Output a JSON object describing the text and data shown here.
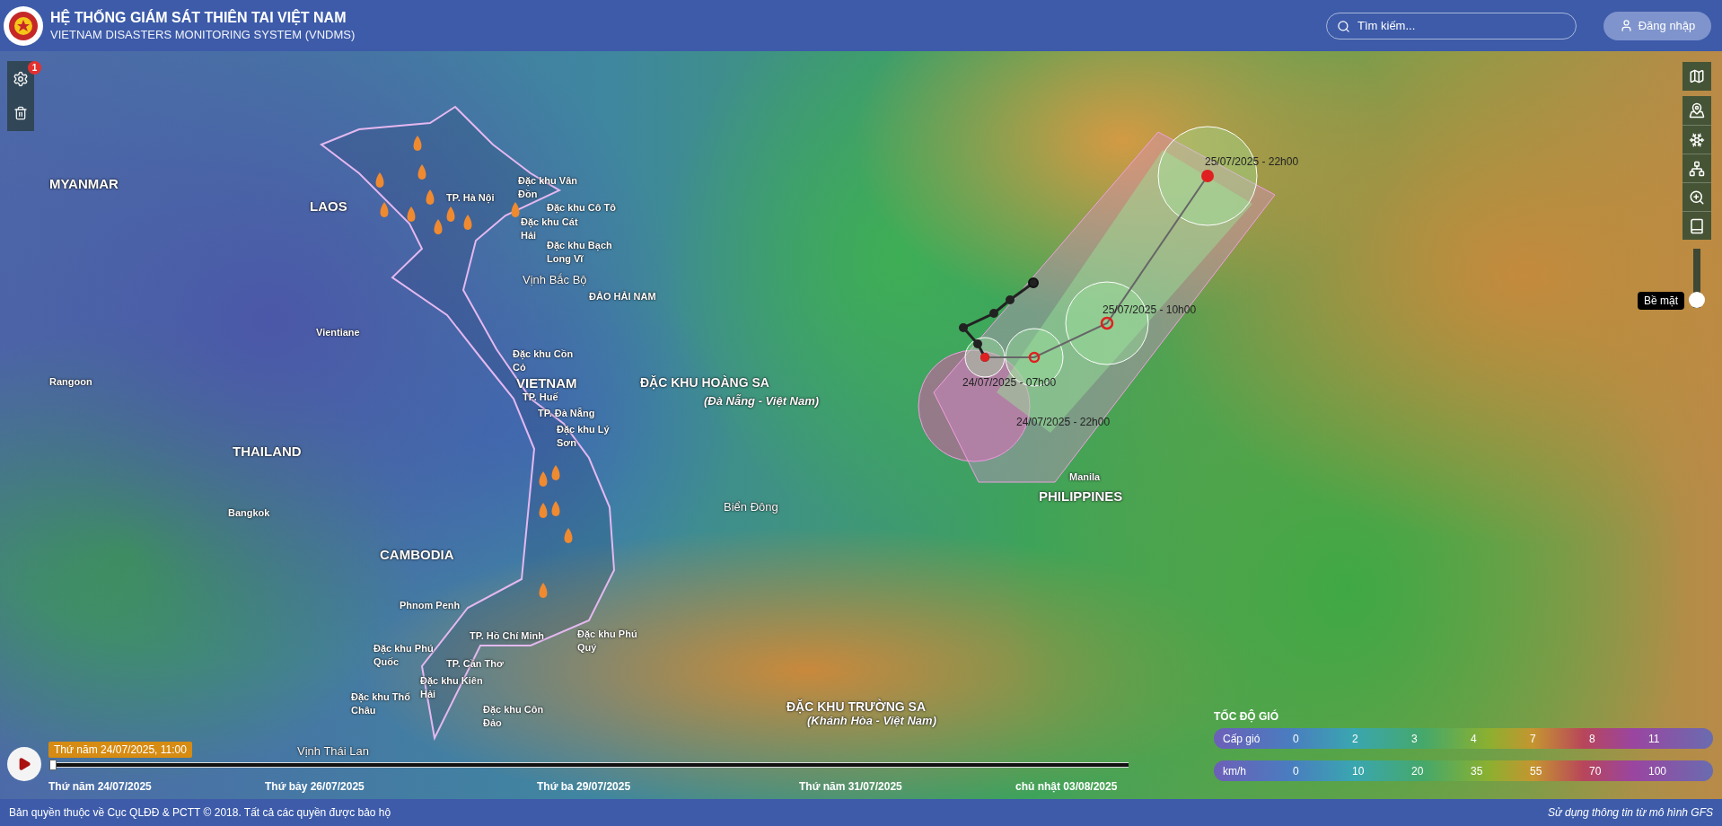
{
  "header": {
    "title": "HỆ THỐNG GIÁM SÁT THIÊN TAI VIỆT NAM",
    "subtitle": "VIETNAM DISASTERS MONITORING SYSTEM (VNDMS)",
    "search": {
      "placeholder": "Tìm kiếm..."
    },
    "login_button": "Đăng nhập"
  },
  "left_tools": {
    "badge": "1"
  },
  "layer_slider": {
    "label": "Bề mặt",
    "level": 0
  },
  "map_labels": [
    {
      "text": "MYANMAR",
      "kind": "country"
    },
    {
      "text": "LAOS",
      "kind": "country"
    },
    {
      "text": "THAILAND",
      "kind": "country"
    },
    {
      "text": "CAMBODIA",
      "kind": "country"
    },
    {
      "text": "VIETNAM",
      "kind": "country"
    },
    {
      "text": "ĐẶC KHU HOÀNG SA",
      "kind": "zone"
    },
    {
      "text": "(Đà Nẵng - Việt Nam)",
      "kind": "zone_sub"
    },
    {
      "text": "Vientiane",
      "kind": "city"
    },
    {
      "text": "Rangoon",
      "kind": "city"
    },
    {
      "text": "Bangkok",
      "kind": "city"
    },
    {
      "text": "Phnom Penh",
      "kind": "city"
    },
    {
      "text": "Vịnh Bắc Bộ",
      "kind": "sea"
    },
    {
      "text": "ĐẢO HẢI NAM",
      "kind": "city"
    },
    {
      "text": "TP. Hà Nội",
      "kind": "city"
    },
    {
      "text": "Đặc khu Vân Đồn",
      "kind": "island"
    },
    {
      "text": "Đặc khu Cô Tô",
      "kind": "city"
    },
    {
      "text": "Đặc khu Cát Hải",
      "kind": "island"
    },
    {
      "text": "Đặc khu Bạch Long Vĩ",
      "kind": "island"
    },
    {
      "text": "Đặc khu Cồn Cỏ",
      "kind": "island"
    },
    {
      "text": "TP. Huế",
      "kind": "city"
    },
    {
      "text": "TP. Đà Nẵng",
      "kind": "city"
    },
    {
      "text": "Đặc khu Lý Sơn",
      "kind": "island"
    },
    {
      "text": "TP. Hồ Chí Minh",
      "kind": "city"
    },
    {
      "text": "TP. Cần Thơ",
      "kind": "city"
    },
    {
      "text": "Đặc khu Phú Quốc",
      "kind": "island"
    },
    {
      "text": "Đặc khu Thổ Châu",
      "kind": "island"
    },
    {
      "text": "Đặc khu Kiên Hải",
      "kind": "island"
    },
    {
      "text": "Đặc khu Côn Đảo",
      "kind": "island"
    },
    {
      "text": "Đặc khu Phú Quý",
      "kind": "island"
    },
    {
      "text": "Biển Đông",
      "kind": "sea"
    },
    {
      "text": "ĐẶC KHU TRƯỜNG SA",
      "kind": "zone"
    },
    {
      "text": "(Khánh Hòa - Việt Nam)",
      "kind": "zone_sub"
    },
    {
      "text": "PHILIPPINES",
      "kind": "country"
    },
    {
      "text": "Manila",
      "kind": "city"
    },
    {
      "text": "Vịnh Thái Lan",
      "kind": "sea"
    }
  ],
  "storm_labels": [
    "25/07/2025 - 22h00",
    "25/07/2025 - 10h00",
    "24/07/2025 - 07h00",
    "24/07/2025 - 22h00"
  ],
  "timeline": {
    "current": "Thứ năm 24/07/2025, 11:00",
    "level": 0,
    "ticks": [
      "Thứ năm 24/07/2025",
      "Thứ bảy 26/07/2025",
      "Thứ ba 29/07/2025",
      "Thứ năm 31/07/2025",
      "chủ nhật 03/08/2025"
    ]
  },
  "legend": {
    "title": "TỐC ĐỘ GIÓ",
    "rows": [
      {
        "label": "Cấp gió",
        "values": [
          "0",
          "2",
          "3",
          "4",
          "7",
          "8",
          "11"
        ]
      },
      {
        "label": "km/h",
        "values": [
          "0",
          "10",
          "20",
          "35",
          "55",
          "70",
          "100"
        ]
      }
    ]
  },
  "footer": {
    "copyright": "Bản quyền thuộc về Cục QLĐĐ & PCTT © 2018. Tất cả các quyền được bảo hộ",
    "source": "Sử dụng thông tin từ mô hình GFS"
  }
}
